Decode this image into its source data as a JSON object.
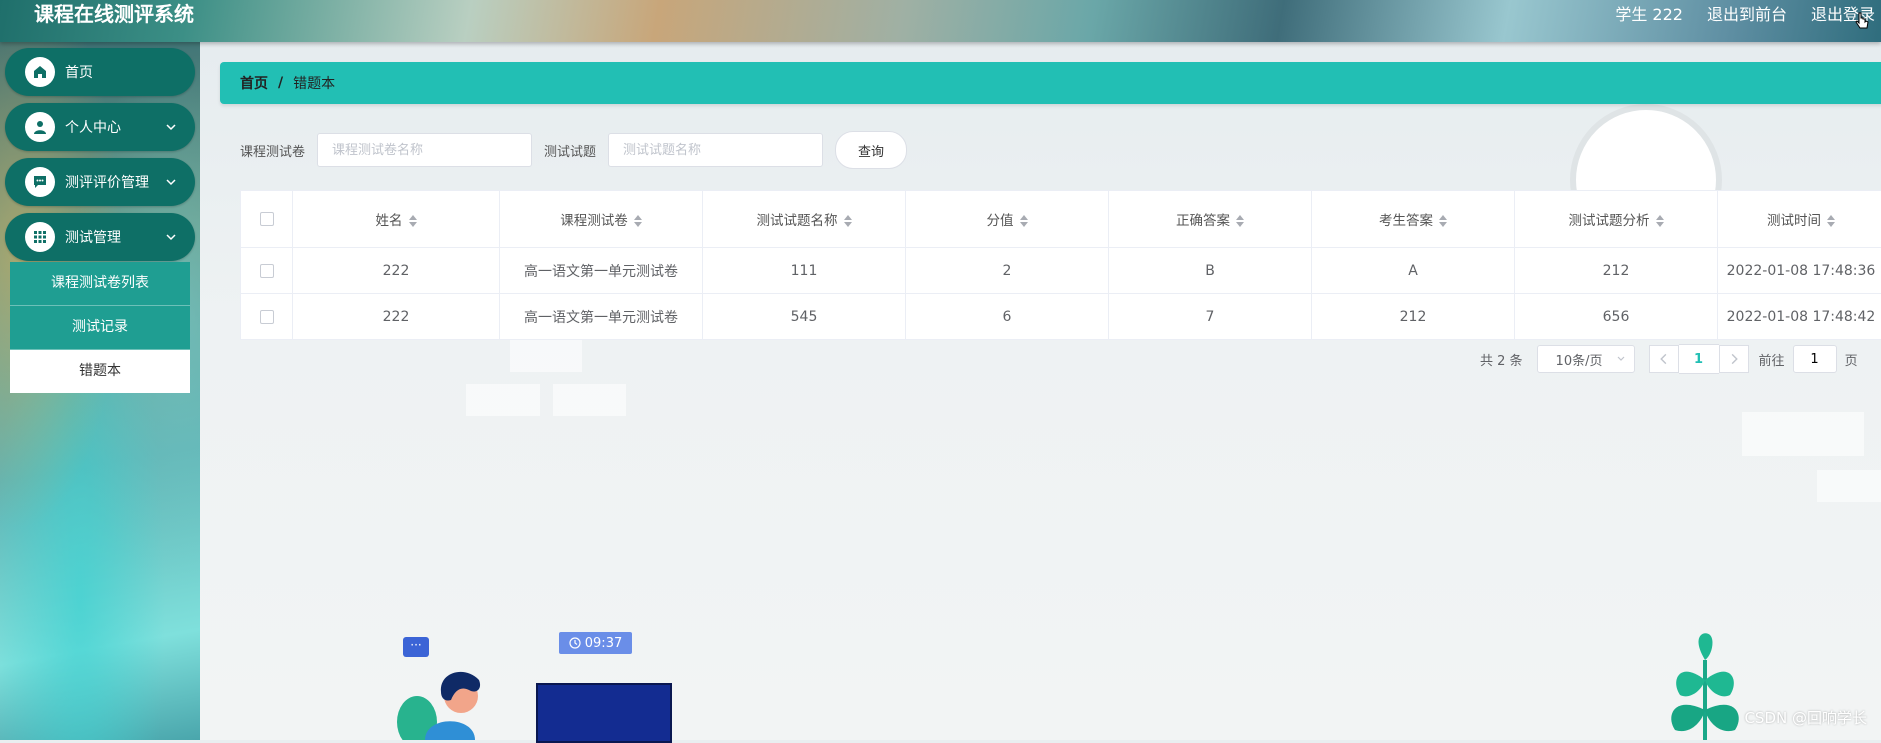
{
  "header": {
    "title": "课程在线测评系统",
    "user": "学生 222",
    "to_front": "退出到前台",
    "logout": "退出登录"
  },
  "sidebar": {
    "items": [
      {
        "label": "首页",
        "icon": "home-icon"
      },
      {
        "label": "个人中心",
        "icon": "user-icon"
      },
      {
        "label": "测评评价管理",
        "icon": "chat-icon"
      },
      {
        "label": "测试管理",
        "icon": "grid-icon"
      }
    ],
    "submenu": [
      "课程测试卷列表",
      "测试记录",
      "错题本"
    ],
    "active_sub": "错题本"
  },
  "breadcrumb": {
    "home": "首页",
    "sep": "/",
    "current": "错题本"
  },
  "search": {
    "paper_label": "课程测试卷",
    "paper_placeholder": "课程测试卷名称",
    "question_label": "测试试题",
    "question_placeholder": "测试试题名称",
    "button": "查询"
  },
  "table": {
    "columns": [
      "姓名",
      "课程测试卷",
      "测试试题名称",
      "分值",
      "正确答案",
      "考生答案",
      "测试试题分析",
      "测试时间"
    ],
    "rows": [
      [
        "222",
        "高一语文第一单元测试卷",
        "111",
        "2",
        "B",
        "A",
        "212",
        "2022-01-08 17:48:36"
      ],
      [
        "222",
        "高一语文第一单元测试卷",
        "545",
        "6",
        "7",
        "212",
        "656",
        "2022-01-08 17:48:42"
      ]
    ]
  },
  "pager": {
    "total": "共 2 条",
    "page_size": "10条/页",
    "current": "1",
    "goto_label": "前往",
    "goto_value": "1",
    "page_unit": "页"
  },
  "illustration": {
    "time": "09:37",
    "chat": "···"
  },
  "watermark": "CSDN @回响学长",
  "colors": {
    "accent": "#22bfb4",
    "menu": "#0e6f66",
    "submenu": "#1f9e92"
  }
}
